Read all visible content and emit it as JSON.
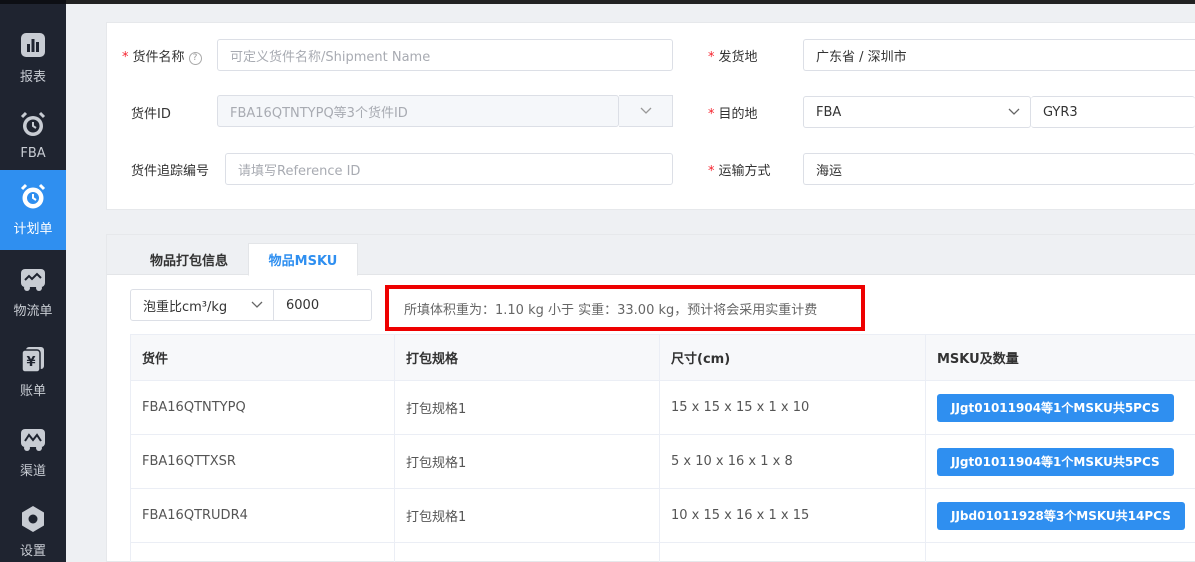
{
  "sidebar": {
    "items": [
      {
        "label": "报表",
        "icon": "bar-chart-icon"
      },
      {
        "label": "FBA",
        "icon": "alarm-clock-icon"
      },
      {
        "label": "计划单",
        "icon": "alarm-clock-icon"
      },
      {
        "label": "物流单",
        "icon": "truck-icon"
      },
      {
        "label": "账单",
        "icon": "yuan-bill-icon"
      },
      {
        "label": "渠道",
        "icon": "channel-truck-icon"
      },
      {
        "label": "设置",
        "icon": "settings-hex-icon"
      }
    ],
    "active_index": 2
  },
  "form": {
    "shipment_name": {
      "label": "货件名称",
      "placeholder": "可定义货件名称/Shipment Name"
    },
    "shipment_id": {
      "label": "货件ID",
      "value": "FBA16QTNTYPQ等3个货件ID"
    },
    "tracking": {
      "label": "货件追踪编号",
      "placeholder": "请填写Reference ID"
    },
    "origin": {
      "label": "发货地",
      "value": "广东省 / 深圳市"
    },
    "destination": {
      "label": "目的地",
      "type_value": "FBA",
      "warehouse_value": "GYR3"
    },
    "transport": {
      "label": "运输方式",
      "value": "海运"
    }
  },
  "tabs": [
    {
      "label": "物品打包信息"
    },
    {
      "label": "物品MSKU"
    }
  ],
  "active_tab": 1,
  "ratio": {
    "select_value": "泡重比cm³/kg",
    "value": "6000"
  },
  "warning": {
    "text": "所填体积重为：1.10 kg 小于 实重：33.00 kg，预计将会采用实重计费"
  },
  "table": {
    "headers": [
      "货件",
      "打包规格",
      "尺寸(cm)",
      "MSKU及数量"
    ],
    "rows": [
      {
        "shipment": "FBA16QTNTYPQ",
        "pack": "打包规格1",
        "size": "15 x 15 x 15 x 1 x 10",
        "msku": "JJgt01011904等1个MSKU共5PCS"
      },
      {
        "shipment": "FBA16QTTXSR",
        "pack": "打包规格1",
        "size": "5 x 10 x 16 x 1 x 8",
        "msku": "JJgt01011904等1个MSKU共5PCS"
      },
      {
        "shipment": "FBA16QTRUDR4",
        "pack": "打包规格1",
        "size": "10 x 15 x 16 x 1 x 15",
        "msku": "JJbd01011928等3个MSKU共14PCS"
      }
    ]
  }
}
